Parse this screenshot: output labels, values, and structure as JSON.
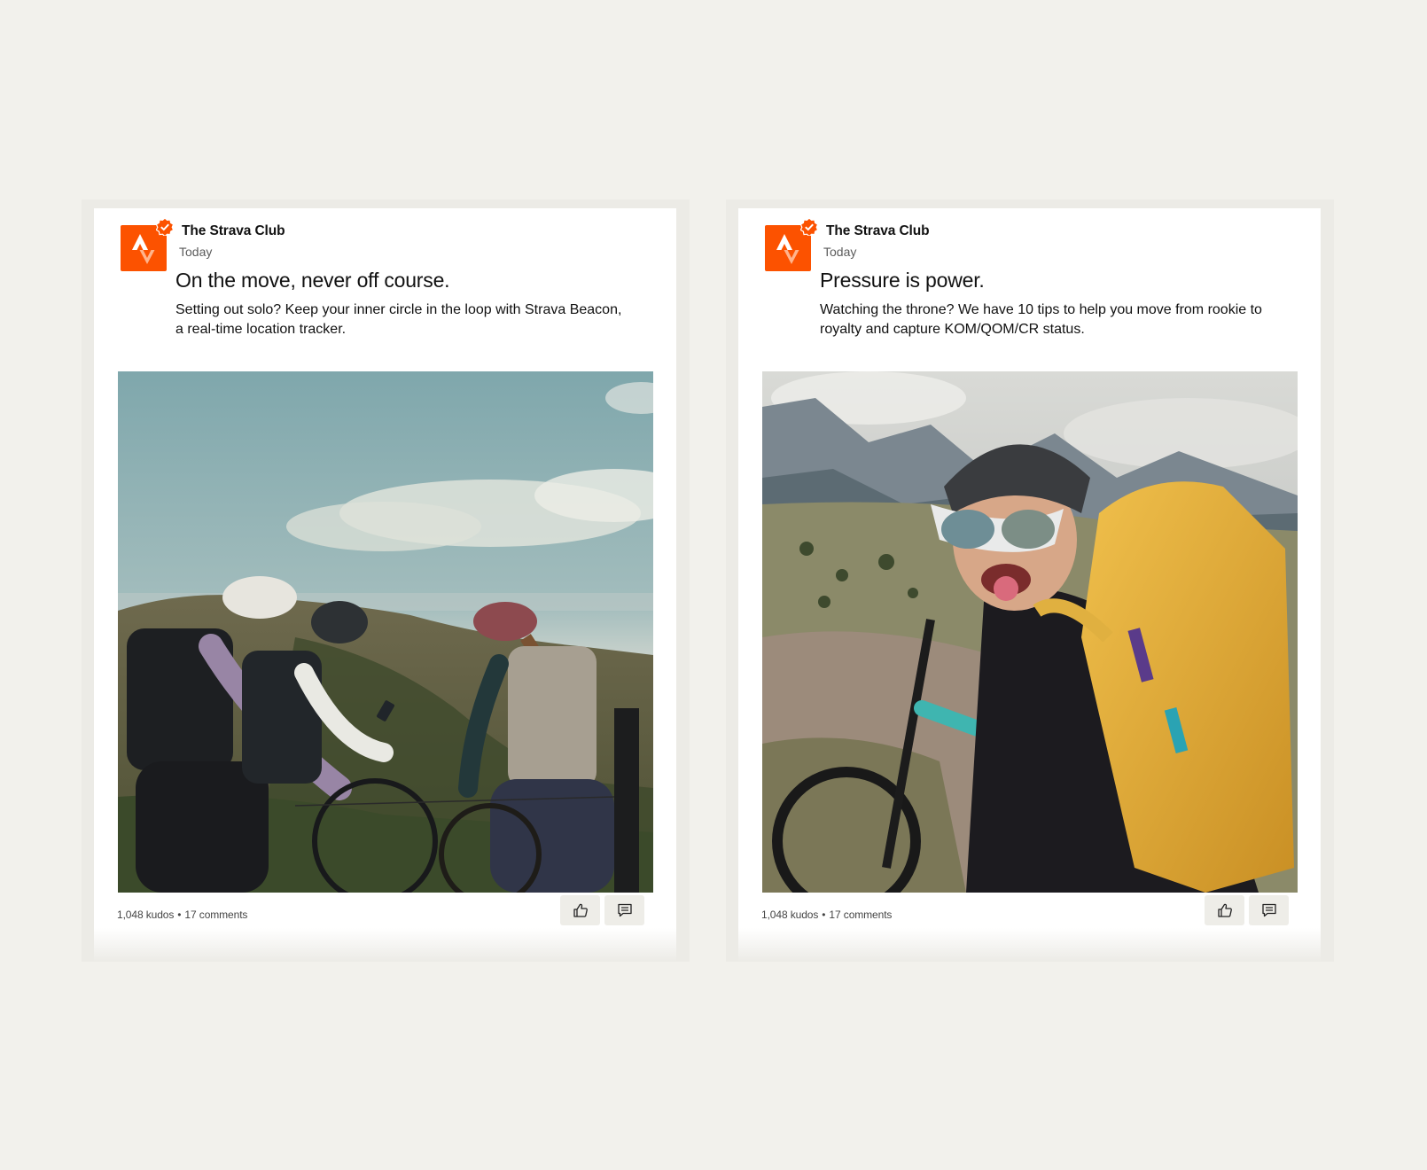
{
  "colors": {
    "brand": "#fc5200",
    "background": "#f2f1ec",
    "card": "#ffffff",
    "button": "#eeede8"
  },
  "posts": [
    {
      "club_name": "The Strava Club",
      "time": "Today",
      "title": "On the move, never off course.",
      "body": "Setting out solo? Keep your inner circle in the loop with Strava Beacon, a real-time location tracker.",
      "kudos": "1,048 kudos",
      "separator": "•",
      "comments": "17 comments",
      "image": "group-of-cyclists-on-hillside-photo",
      "icons": [
        "strava-logo-icon",
        "verified-badge-icon",
        "thumbs-up-icon",
        "comment-icon"
      ]
    },
    {
      "club_name": "The Strava Club",
      "time": "Today",
      "title": "Pressure is power.",
      "body": "Watching the throne? We have 10 tips to help you move from rookie to royalty and capture KOM/QOM/CR status.",
      "kudos": "1,048 kudos",
      "separator": "•",
      "comments": "17 comments",
      "image": "mountain-biker-selfie-photo",
      "icons": [
        "strava-logo-icon",
        "verified-badge-icon",
        "thumbs-up-icon",
        "comment-icon"
      ]
    }
  ]
}
